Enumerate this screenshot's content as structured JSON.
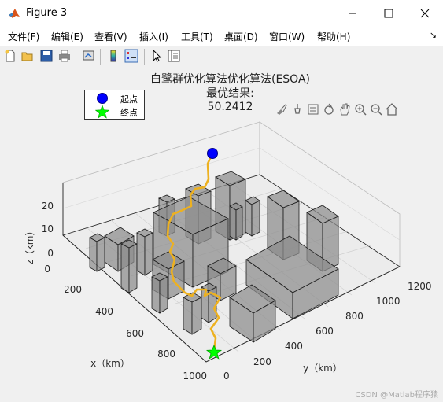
{
  "window": {
    "title": "Figure 3"
  },
  "menu": {
    "items": [
      "文件(F)",
      "编辑(E)",
      "查看(V)",
      "插入(I)",
      "工具(T)",
      "桌面(D)",
      "窗口(W)",
      "帮助(H)"
    ]
  },
  "toolbar": {
    "icons": [
      "new-figure-icon",
      "open-file-icon",
      "save-icon",
      "print-icon",
      "link-plot-icon",
      "colorbar-icon",
      "legend-icon",
      "edit-plot-icon",
      "property-inspector-icon"
    ]
  },
  "plot": {
    "title_line1": "白鹭群优化算法优化算法(ESOA)",
    "title_line2": "最优结果:",
    "title_line3": "50.2412",
    "legend": [
      {
        "label": "起点",
        "marker": "circle",
        "color": "#0000ff"
      },
      {
        "label": "终点",
        "marker": "pentagram",
        "color": "#00ff00"
      }
    ],
    "axes": {
      "x_label": "x（km）",
      "y_label": "y（km）",
      "z_label": "z（km）",
      "x_ticks": [
        "0",
        "200",
        "400",
        "600",
        "800",
        "1000"
      ],
      "y_ticks": [
        "0",
        "200",
        "400",
        "600",
        "800",
        "1000",
        "1200"
      ],
      "z_ticks": [
        "0",
        "10",
        "20"
      ]
    },
    "colors": {
      "path": "#edb120",
      "obstacle_fill": "#8c8c8c",
      "obstacle_edge": "#1e1e1e"
    }
  },
  "axes_toolbar": {
    "icons": [
      "brush-icon",
      "data-tips-icon",
      "restore-view-icon",
      "rotate-icon",
      "pan-icon",
      "zoom-in-icon",
      "zoom-out-icon",
      "home-icon"
    ]
  },
  "watermark": "CSDN @Matlab程序猿"
}
